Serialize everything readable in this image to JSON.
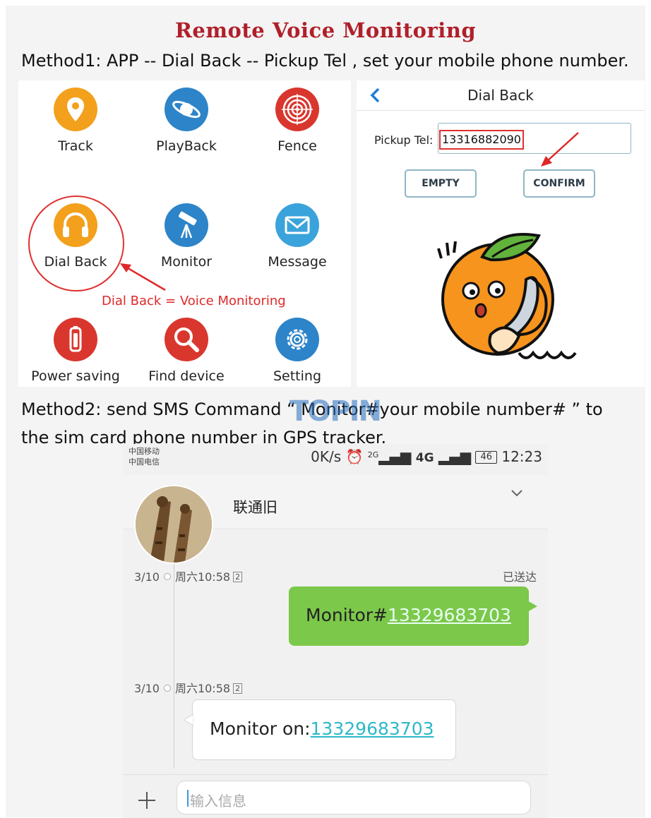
{
  "title": "Remote Voice Monitoring",
  "method1": "Method1: APP -- Dial Back -- Pickup Tel , set your mobile phone number.",
  "app_grid": {
    "items": [
      {
        "label": "Track",
        "icon": "location-pin-icon",
        "color": "#f3a01c"
      },
      {
        "label": "PlayBack",
        "icon": "orbit-icon",
        "color": "#2d84c8"
      },
      {
        "label": "Fence",
        "icon": "target-icon",
        "color": "#d9372e"
      },
      {
        "label": "Dial Back",
        "icon": "headphones-icon",
        "color": "#f3a01c"
      },
      {
        "label": "Monitor",
        "icon": "telescope-icon",
        "color": "#2d84c8"
      },
      {
        "label": "Message",
        "icon": "envelope-icon",
        "color": "#3ba3db"
      },
      {
        "label": "Power saving",
        "icon": "battery-icon",
        "color": "#d9372e"
      },
      {
        "label": "Find device",
        "icon": "magnifier-icon",
        "color": "#d9372e"
      },
      {
        "label": "Setting",
        "icon": "gear-icon",
        "color": "#2d84c8"
      }
    ],
    "caption": "Dial Back = Voice Monitoring"
  },
  "dial_back": {
    "title": "Dial Back",
    "pickup_label": "Pickup Tel:",
    "pickup_value": "13316882090",
    "empty_button": "EMPTY",
    "confirm_button": "CONFIRM"
  },
  "method2_line1": "Method2: send SMS Command  “ Monitor#your mobile number# ”  to",
  "method2_line2": "the sim card phone number in GPS tracker.",
  "watermark": "TOPIN",
  "phone": {
    "carrier1": "中国移动",
    "carrier2": "中国电信",
    "speed": "0K/s",
    "network_2g": "2G",
    "network_4g": "4G",
    "battery": "46",
    "time": "12:23",
    "contact_name": "联通旧",
    "messages": [
      {
        "date": "3/10",
        "time": "周六10:58",
        "sim": "2",
        "status": "已送达",
        "prefix": "Monitor#",
        "number": "13329683703",
        "direction": "out"
      },
      {
        "date": "3/10",
        "time": "周六10:58",
        "sim": "2",
        "prefix": "Monitor on:",
        "number": "13329683703",
        "direction": "in"
      }
    ],
    "input_placeholder": "输入信息"
  }
}
